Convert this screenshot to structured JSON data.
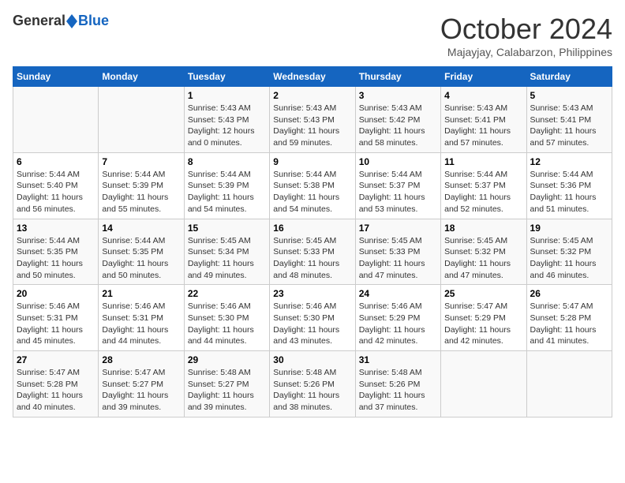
{
  "logo": {
    "general": "General",
    "blue": "Blue"
  },
  "title": "October 2024",
  "location": "Majayjay, Calabarzon, Philippines",
  "days_header": [
    "Sunday",
    "Monday",
    "Tuesday",
    "Wednesday",
    "Thursday",
    "Friday",
    "Saturday"
  ],
  "weeks": [
    [
      {
        "day": "",
        "info": ""
      },
      {
        "day": "",
        "info": ""
      },
      {
        "day": "1",
        "info": "Sunrise: 5:43 AM\nSunset: 5:43 PM\nDaylight: 12 hours\nand 0 minutes."
      },
      {
        "day": "2",
        "info": "Sunrise: 5:43 AM\nSunset: 5:43 PM\nDaylight: 11 hours\nand 59 minutes."
      },
      {
        "day": "3",
        "info": "Sunrise: 5:43 AM\nSunset: 5:42 PM\nDaylight: 11 hours\nand 58 minutes."
      },
      {
        "day": "4",
        "info": "Sunrise: 5:43 AM\nSunset: 5:41 PM\nDaylight: 11 hours\nand 57 minutes."
      },
      {
        "day": "5",
        "info": "Sunrise: 5:43 AM\nSunset: 5:41 PM\nDaylight: 11 hours\nand 57 minutes."
      }
    ],
    [
      {
        "day": "6",
        "info": "Sunrise: 5:44 AM\nSunset: 5:40 PM\nDaylight: 11 hours\nand 56 minutes."
      },
      {
        "day": "7",
        "info": "Sunrise: 5:44 AM\nSunset: 5:39 PM\nDaylight: 11 hours\nand 55 minutes."
      },
      {
        "day": "8",
        "info": "Sunrise: 5:44 AM\nSunset: 5:39 PM\nDaylight: 11 hours\nand 54 minutes."
      },
      {
        "day": "9",
        "info": "Sunrise: 5:44 AM\nSunset: 5:38 PM\nDaylight: 11 hours\nand 54 minutes."
      },
      {
        "day": "10",
        "info": "Sunrise: 5:44 AM\nSunset: 5:37 PM\nDaylight: 11 hours\nand 53 minutes."
      },
      {
        "day": "11",
        "info": "Sunrise: 5:44 AM\nSunset: 5:37 PM\nDaylight: 11 hours\nand 52 minutes."
      },
      {
        "day": "12",
        "info": "Sunrise: 5:44 AM\nSunset: 5:36 PM\nDaylight: 11 hours\nand 51 minutes."
      }
    ],
    [
      {
        "day": "13",
        "info": "Sunrise: 5:44 AM\nSunset: 5:35 PM\nDaylight: 11 hours\nand 50 minutes."
      },
      {
        "day": "14",
        "info": "Sunrise: 5:44 AM\nSunset: 5:35 PM\nDaylight: 11 hours\nand 50 minutes."
      },
      {
        "day": "15",
        "info": "Sunrise: 5:45 AM\nSunset: 5:34 PM\nDaylight: 11 hours\nand 49 minutes."
      },
      {
        "day": "16",
        "info": "Sunrise: 5:45 AM\nSunset: 5:33 PM\nDaylight: 11 hours\nand 48 minutes."
      },
      {
        "day": "17",
        "info": "Sunrise: 5:45 AM\nSunset: 5:33 PM\nDaylight: 11 hours\nand 47 minutes."
      },
      {
        "day": "18",
        "info": "Sunrise: 5:45 AM\nSunset: 5:32 PM\nDaylight: 11 hours\nand 47 minutes."
      },
      {
        "day": "19",
        "info": "Sunrise: 5:45 AM\nSunset: 5:32 PM\nDaylight: 11 hours\nand 46 minutes."
      }
    ],
    [
      {
        "day": "20",
        "info": "Sunrise: 5:46 AM\nSunset: 5:31 PM\nDaylight: 11 hours\nand 45 minutes."
      },
      {
        "day": "21",
        "info": "Sunrise: 5:46 AM\nSunset: 5:31 PM\nDaylight: 11 hours\nand 44 minutes."
      },
      {
        "day": "22",
        "info": "Sunrise: 5:46 AM\nSunset: 5:30 PM\nDaylight: 11 hours\nand 44 minutes."
      },
      {
        "day": "23",
        "info": "Sunrise: 5:46 AM\nSunset: 5:30 PM\nDaylight: 11 hours\nand 43 minutes."
      },
      {
        "day": "24",
        "info": "Sunrise: 5:46 AM\nSunset: 5:29 PM\nDaylight: 11 hours\nand 42 minutes."
      },
      {
        "day": "25",
        "info": "Sunrise: 5:47 AM\nSunset: 5:29 PM\nDaylight: 11 hours\nand 42 minutes."
      },
      {
        "day": "26",
        "info": "Sunrise: 5:47 AM\nSunset: 5:28 PM\nDaylight: 11 hours\nand 41 minutes."
      }
    ],
    [
      {
        "day": "27",
        "info": "Sunrise: 5:47 AM\nSunset: 5:28 PM\nDaylight: 11 hours\nand 40 minutes."
      },
      {
        "day": "28",
        "info": "Sunrise: 5:47 AM\nSunset: 5:27 PM\nDaylight: 11 hours\nand 39 minutes."
      },
      {
        "day": "29",
        "info": "Sunrise: 5:48 AM\nSunset: 5:27 PM\nDaylight: 11 hours\nand 39 minutes."
      },
      {
        "day": "30",
        "info": "Sunrise: 5:48 AM\nSunset: 5:26 PM\nDaylight: 11 hours\nand 38 minutes."
      },
      {
        "day": "31",
        "info": "Sunrise: 5:48 AM\nSunset: 5:26 PM\nDaylight: 11 hours\nand 37 minutes."
      },
      {
        "day": "",
        "info": ""
      },
      {
        "day": "",
        "info": ""
      }
    ]
  ]
}
